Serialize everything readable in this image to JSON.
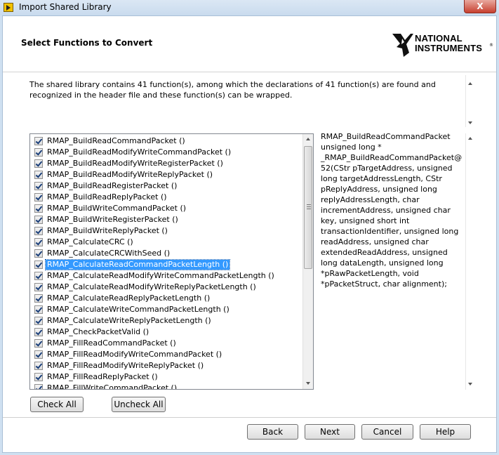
{
  "window": {
    "title": "Import Shared Library",
    "close_label": "X"
  },
  "header": {
    "title": "Select Functions to Convert",
    "logo_lines": [
      "NATIONAL",
      "INSTRUMENTS"
    ],
    "logo_reg": "®"
  },
  "description": "The shared library contains 41 function(s), among which the declarations of 41 function(s) are found and recognized in the header file and these function(s) can be wrapped.",
  "functions": [
    {
      "label": "RMAP_BuildReadCommandPacket ()",
      "checked": true
    },
    {
      "label": "RMAP_BuildReadModifyWriteCommandPacket ()",
      "checked": true
    },
    {
      "label": "RMAP_BuildReadModifyWriteRegisterPacket ()",
      "checked": true
    },
    {
      "label": "RMAP_BuildReadModifyWriteReplyPacket ()",
      "checked": true
    },
    {
      "label": "RMAP_BuildReadRegisterPacket ()",
      "checked": true
    },
    {
      "label": "RMAP_BuildReadReplyPacket ()",
      "checked": true
    },
    {
      "label": "RMAP_BuildWriteCommandPacket ()",
      "checked": true
    },
    {
      "label": "RMAP_BuildWriteRegisterPacket ()",
      "checked": true
    },
    {
      "label": "RMAP_BuildWriteReplyPacket ()",
      "checked": true
    },
    {
      "label": "RMAP_CalculateCRC ()",
      "checked": true
    },
    {
      "label": "RMAP_CalculateCRCWithSeed ()",
      "checked": true
    },
    {
      "label": "RMAP_CalculateReadCommandPacketLength ()",
      "checked": true,
      "selected": true
    },
    {
      "label": "RMAP_CalculateReadModifyWriteCommandPacketLength ()",
      "checked": true
    },
    {
      "label": "RMAP_CalculateReadModifyWriteReplyPacketLength ()",
      "checked": true
    },
    {
      "label": "RMAP_CalculateReadReplyPacketLength ()",
      "checked": true
    },
    {
      "label": "RMAP_CalculateWriteCommandPacketLength ()",
      "checked": true
    },
    {
      "label": "RMAP_CalculateWriteReplyPacketLength ()",
      "checked": true
    },
    {
      "label": "RMAP_CheckPacketValid ()",
      "checked": true
    },
    {
      "label": "RMAP_FillReadCommandPacket ()",
      "checked": true
    },
    {
      "label": "RMAP_FillReadModifyWriteCommandPacket ()",
      "checked": true
    },
    {
      "label": "RMAP_FillReadModifyWriteReplyPacket ()",
      "checked": true
    },
    {
      "label": "RMAP_FillReadReplyPacket ()",
      "checked": true
    },
    {
      "label": "RMAP_FillWriteCommandPacket ()",
      "checked": true
    }
  ],
  "prototype": "RMAP_BuildReadCommandPacket unsigned long * _RMAP_BuildReadCommandPacket@52(CStr pTargetAddress, unsigned long targetAddressLength, CStr pReplyAddress, unsigned long replyAddressLength, char incrementAddress, unsigned char key, unsigned short int transactionIdentifier, unsigned long readAddress, unsigned char extendedReadAddress, unsigned long dataLength, unsigned long *pRawPacketLength, void *pPacketStruct, char alignment);",
  "buttons": {
    "check_all": "Check All",
    "uncheck_all": "Uncheck All",
    "back": "Back",
    "next": "Next",
    "cancel": "Cancel",
    "help": "Help"
  }
}
